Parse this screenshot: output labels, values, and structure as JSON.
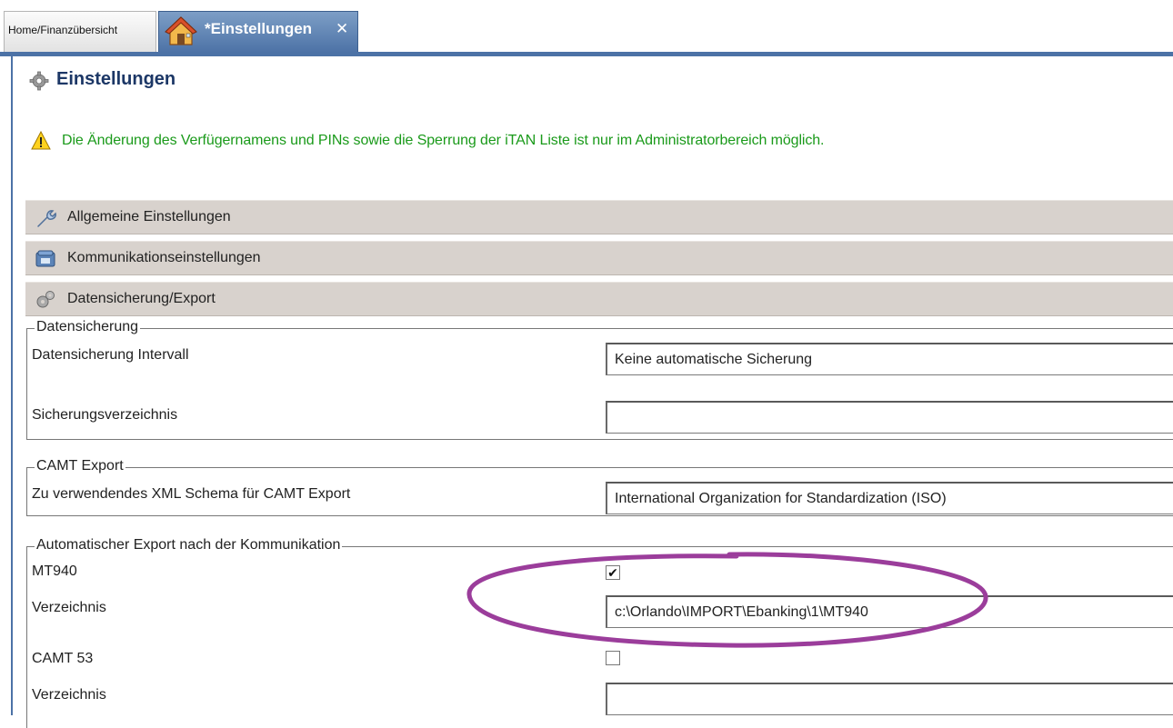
{
  "tabs": [
    {
      "label": "Home/Finanzübersicht"
    },
    {
      "label": "*Einstellungen",
      "close": "✕"
    }
  ],
  "page": {
    "title": "Einstellungen",
    "warning": "Die Änderung des Verfügernamens und PINs sowie die Sperrung der iTAN Liste ist nur im Administratorbereich möglich."
  },
  "sections": [
    {
      "label": "Allgemeine Einstellungen",
      "icon": "wrench-icon"
    },
    {
      "label": "Kommunikationseinstellungen",
      "icon": "telephone-icon"
    },
    {
      "label": "Datensicherung/Export",
      "icon": "gears-icon"
    }
  ],
  "datensicherung": {
    "legend": "Datensicherung",
    "interval_label": "Datensicherung Intervall",
    "interval_value": "Keine automatische Sicherung",
    "dir_label": "Sicherungsverzeichnis",
    "dir_value": ""
  },
  "camt_export": {
    "legend": "CAMT Export",
    "schema_label": "Zu verwendendes XML Schema für CAMT Export",
    "schema_value": "International Organization for Standardization (ISO)"
  },
  "auto_export": {
    "legend": "Automatischer Export nach der Kommunikation",
    "mt940_label": "MT940",
    "mt940_checked": true,
    "mt940_check_glyph": "✔",
    "mt940_dir_label": "Verzeichnis",
    "mt940_dir_value": "c:\\Orlando\\IMPORT\\Ebanking\\1\\MT940",
    "camt53_label": "CAMT 53",
    "camt53_checked": false,
    "camt53_dir_label": "Verzeichnis",
    "camt53_dir_value": ""
  },
  "colors": {
    "accent": "#4c72a6",
    "title": "#1c3766",
    "warning_text": "#1a9a1a",
    "section_bar": "#d8d2cd",
    "annotation": "#9b3d9b"
  }
}
